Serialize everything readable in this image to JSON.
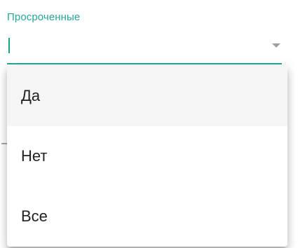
{
  "field": {
    "label": "Просроченные",
    "value": "",
    "accent_color": "#26a69a",
    "arrow_icon": "arrow-drop-down-icon"
  },
  "dropdown": {
    "options": [
      {
        "label": "Да",
        "highlighted": true
      },
      {
        "label": "Нет",
        "highlighted": false
      },
      {
        "label": "Все",
        "highlighted": false
      }
    ]
  }
}
